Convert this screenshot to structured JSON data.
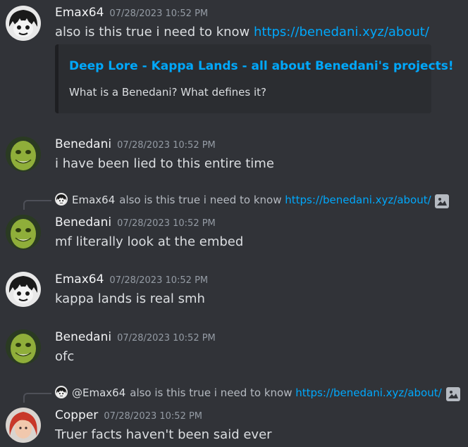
{
  "messages": [
    {
      "author": "Emax64",
      "timestamp": "07/28/2023 10:52 PM",
      "avatar": "emax-avatar",
      "text": "also is this true i need to know ",
      "link": "https://benedani.xyz/about/",
      "embed": {
        "title": "Deep Lore - Kappa Lands - all about Benedani's projects!",
        "description": "What is a Benedani? What defines it?"
      }
    },
    {
      "author": "Benedani",
      "timestamp": "07/28/2023 10:52 PM",
      "avatar": "benedani-avatar",
      "text": "i have been lied to this entire time"
    },
    {
      "reply": {
        "author": "Emax64",
        "text": "also is this true i need to know ",
        "link": "https://benedani.xyz/about/"
      },
      "author": "Benedani",
      "timestamp": "07/28/2023 10:52 PM",
      "avatar": "benedani-avatar",
      "text": "mf literally look at the embed"
    },
    {
      "author": "Emax64",
      "timestamp": "07/28/2023 10:52 PM",
      "avatar": "emax-avatar",
      "text": "kappa lands is real smh"
    },
    {
      "author": "Benedani",
      "timestamp": "07/28/2023 10:52 PM",
      "avatar": "benedani-avatar",
      "text": "ofc"
    },
    {
      "reply": {
        "author": "@Emax64",
        "text": "also is this true i need to know ",
        "link": "https://benedani.xyz/about/"
      },
      "author": "Copper",
      "timestamp": "07/28/2023 10:52 PM",
      "avatar": "copper-avatar",
      "text": "Truer facts haven't been said ever"
    }
  ],
  "colors": {
    "background": "#313338",
    "link": "#00a8fc",
    "embed_bg": "#2b2d31"
  }
}
